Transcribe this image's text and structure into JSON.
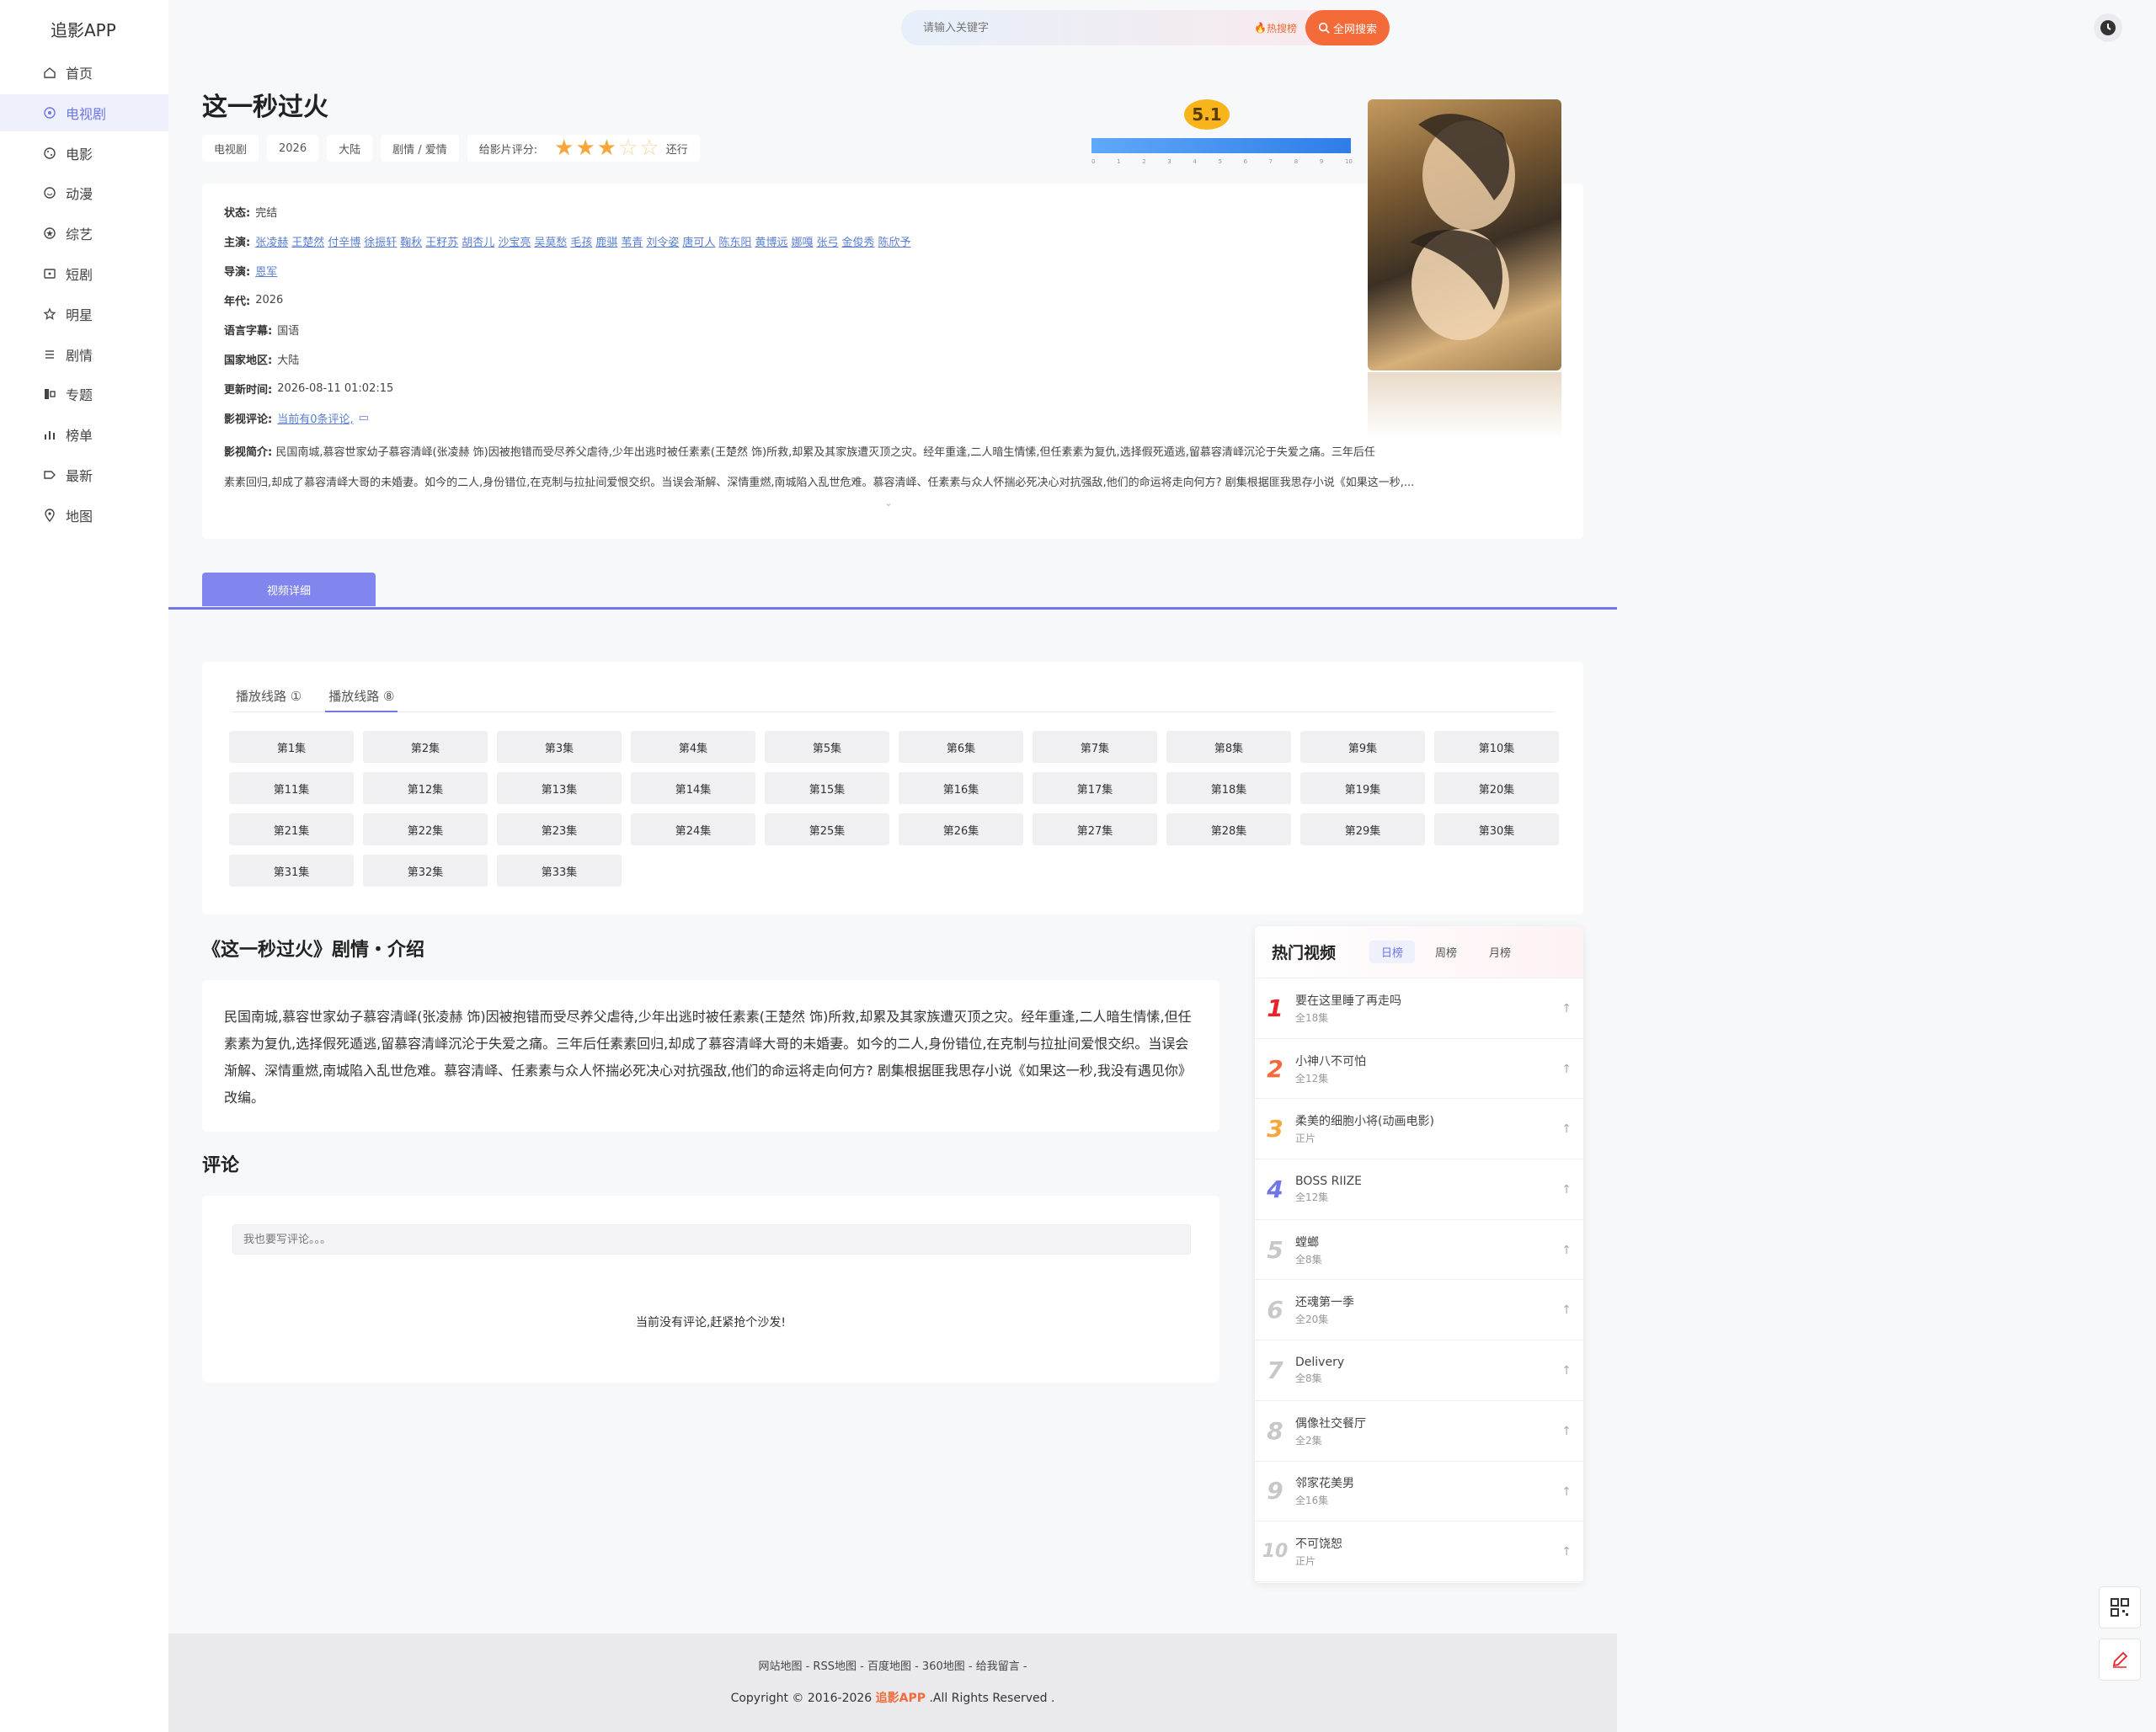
{
  "app": {
    "brand": "追影APP"
  },
  "sidebar": {
    "items": [
      {
        "label": "首页",
        "icon": "home-icon"
      },
      {
        "label": "电视剧",
        "icon": "tv-icon",
        "active": true
      },
      {
        "label": "电影",
        "icon": "film-icon"
      },
      {
        "label": "动漫",
        "icon": "anime-icon"
      },
      {
        "label": "综艺",
        "icon": "variety-icon"
      },
      {
        "label": "短剧",
        "icon": "short-icon"
      },
      {
        "label": "明星",
        "icon": "star-icon"
      },
      {
        "label": "剧情",
        "icon": "list-icon"
      },
      {
        "label": "专题",
        "icon": "topic-icon"
      },
      {
        "label": "榜单",
        "icon": "chart-icon"
      },
      {
        "label": "最新",
        "icon": "new-icon"
      },
      {
        "label": "地图",
        "icon": "map-pin-icon"
      }
    ]
  },
  "search": {
    "placeholder": "请输入关键字",
    "hot_label": "热搜榜",
    "button_label": "全网搜索"
  },
  "detail": {
    "title": "这一秒过火",
    "tags": [
      "电视剧",
      "2026",
      "大陆",
      "剧情 / 爱情"
    ],
    "rate_label": "给影片评分:",
    "stars_filled": 3,
    "stars_total": 5,
    "rating_word": "还行",
    "score": "5.1",
    "score_ticks": [
      "0",
      "1",
      "2",
      "3",
      "4",
      "5",
      "6",
      "7",
      "8",
      "9",
      "10"
    ],
    "status_label": "状态:",
    "status": "完结",
    "cast_label": "主演:",
    "cast": [
      "张凌赫",
      "王楚然",
      "付辛博",
      "徐振轩",
      "鞠秋",
      "王籽苏",
      "胡杏儿",
      "沙宝亮",
      "吴莫愁",
      "毛孩",
      "鹿骐",
      "苇青",
      "刘令姿",
      "唐可人",
      "陈东阳",
      "黄博远",
      "娜嘎",
      "张弓",
      "金俊秀",
      "陈欣予"
    ],
    "director_label": "导演:",
    "director": "恩军",
    "year_label": "年代:",
    "year": "2026",
    "language_label": "语言字幕:",
    "language": "国语",
    "region_label": "国家地区:",
    "region": "大陆",
    "updated_label": "更新时间:",
    "updated": "2026-08-11 01:02:15",
    "review_label": "影视评论:",
    "review": "当前有0条评论,",
    "summary_label": "影视简介:",
    "summary_line1": "民国南城,慕容世家幼子慕容清峄(张凌赫 饰)因被抱错而受尽养父虐待,少年出逃时被任素素(王楚然 饰)所救,却累及其家族遭灭顶之灾。经年重逢,二人暗生情愫,但任素素为复仇,选择假死遁逃,留慕容清峄沉沦于失爱之痛。三年后任",
    "summary_line2": "素素回归,却成了慕容清峄大哥的未婚妻。如今的二人,身份错位,在克制与拉扯间爱恨交织。当误会渐解、深情重燃,南城陷入乱世危难。慕容清峄、任素素与众人怀揣必死决心对抗强敌,他们的命运将走向何方? 剧集根据匪我思存小说《如果这一秒,..."
  },
  "tabs": {
    "video_detail": "视频详细"
  },
  "play": {
    "lines": [
      {
        "label": "播放线路 ①"
      },
      {
        "label": "播放线路 ⑧",
        "active": true
      }
    ],
    "episodes": [
      "第1集",
      "第2集",
      "第3集",
      "第4集",
      "第5集",
      "第6集",
      "第7集",
      "第8集",
      "第9集",
      "第10集",
      "第11集",
      "第12集",
      "第13集",
      "第14集",
      "第15集",
      "第16集",
      "第17集",
      "第18集",
      "第19集",
      "第20集",
      "第21集",
      "第22集",
      "第23集",
      "第24集",
      "第25集",
      "第26集",
      "第27集",
      "第28集",
      "第29集",
      "第30集",
      "第31集",
      "第32集",
      "第33集"
    ]
  },
  "intro": {
    "title": "《这一秒过火》剧情・介绍",
    "text": "民国南城,慕容世家幼子慕容清峄(张凌赫 饰)因被抱错而受尽养父虐待,少年出逃时被任素素(王楚然 饰)所救,却累及其家族遭灭顶之灾。经年重逢,二人暗生情愫,但任素素为复仇,选择假死遁逃,留慕容清峄沉沦于失爱之痛。三年后任素素回归,却成了慕容清峄大哥的未婚妻。如今的二人,身份错位,在克制与拉扯间爱恨交织。当误会渐解、深情重燃,南城陷入乱世危难。慕容清峄、任素素与众人怀揣必死决心对抗强敌,他们的命运将走向何方? 剧集根据匪我思存小说《如果这一秒,我没有遇见你》改编。"
  },
  "comments": {
    "title": "评论",
    "placeholder": "我也要写评论。。。",
    "empty": "当前没有评论,赶紧抢个沙发!"
  },
  "hot": {
    "title": "热门视频",
    "tabs": [
      {
        "label": "日榜",
        "active": true
      },
      {
        "label": "周榜"
      },
      {
        "label": "月榜"
      }
    ],
    "items": [
      {
        "rank": "1",
        "name": "要在这里睡了再走吗",
        "sub": "全18集",
        "color": "#e8232c"
      },
      {
        "rank": "2",
        "name": "小神八不可怕",
        "sub": "全12集",
        "color": "#f46a39"
      },
      {
        "rank": "3",
        "name": "柔美的细胞小将(动画电影)",
        "sub": "正片",
        "color": "#f6a63a"
      },
      {
        "rank": "4",
        "name": "BOSS RIIZE",
        "sub": "全12集",
        "color": "#6e76e8"
      },
      {
        "rank": "5",
        "name": "螳螂",
        "sub": "全8集",
        "color": "#c8c8c8"
      },
      {
        "rank": "6",
        "name": "还魂第一季",
        "sub": "全20集",
        "color": "#c8c8c8"
      },
      {
        "rank": "7",
        "name": "Delivery",
        "sub": "全8集",
        "color": "#c8c8c8"
      },
      {
        "rank": "8",
        "name": "偶像社交餐厅",
        "sub": "全2集",
        "color": "#c8c8c8"
      },
      {
        "rank": "9",
        "name": "邻家花美男",
        "sub": "全16集",
        "color": "#c8c8c8"
      },
      {
        "rank": "10",
        "name": "不可饶恕",
        "sub": "正片",
        "color": "#c8c8c8"
      }
    ]
  },
  "footer": {
    "links": [
      "网站地图",
      "RSS地图",
      "百度地图",
      "360地图",
      "给我留言"
    ],
    "copy_prefix": "Copyright © 2016-2026 ",
    "copy_brand": "追影APP",
    "copy_suffix": " .All Rights Reserved ."
  }
}
